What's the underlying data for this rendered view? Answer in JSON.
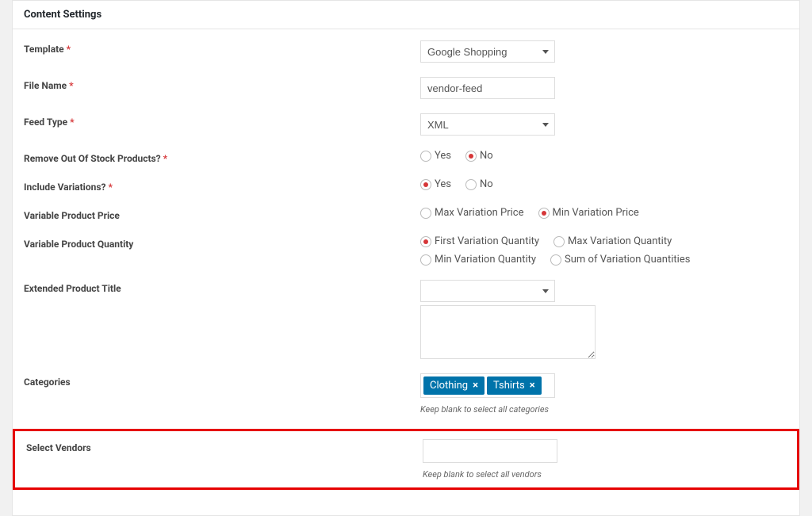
{
  "header": "Content Settings",
  "labels": {
    "template": "Template",
    "filename": "File Name",
    "feedtype": "Feed Type",
    "removestock": "Remove Out Of Stock Products?",
    "includevar": "Include Variations?",
    "varprice": "Variable Product Price",
    "varqty": "Variable Product Quantity",
    "exttitle": "Extended Product Title",
    "categories": "Categories",
    "vendors": "Select Vendors"
  },
  "values": {
    "template": "Google Shopping",
    "filename": "vendor-feed",
    "feedtype": "XML"
  },
  "radios": {
    "yes": "Yes",
    "no": "No",
    "maxvar": "Max Variation Price",
    "minvar": "Min Variation Price",
    "firstqty": "First Variation Quantity",
    "maxqty": "Max Variation Quantity",
    "minqty": "Min Variation Quantity",
    "sumqty": "Sum of Variation Quantities"
  },
  "tags": {
    "clothing": "Clothing",
    "tshirts": "Tshirts"
  },
  "hints": {
    "categories": "Keep blank to select all categories",
    "vendors": "Keep blank to select all vendors"
  },
  "misc": {
    "required": "*",
    "remove": "×"
  }
}
